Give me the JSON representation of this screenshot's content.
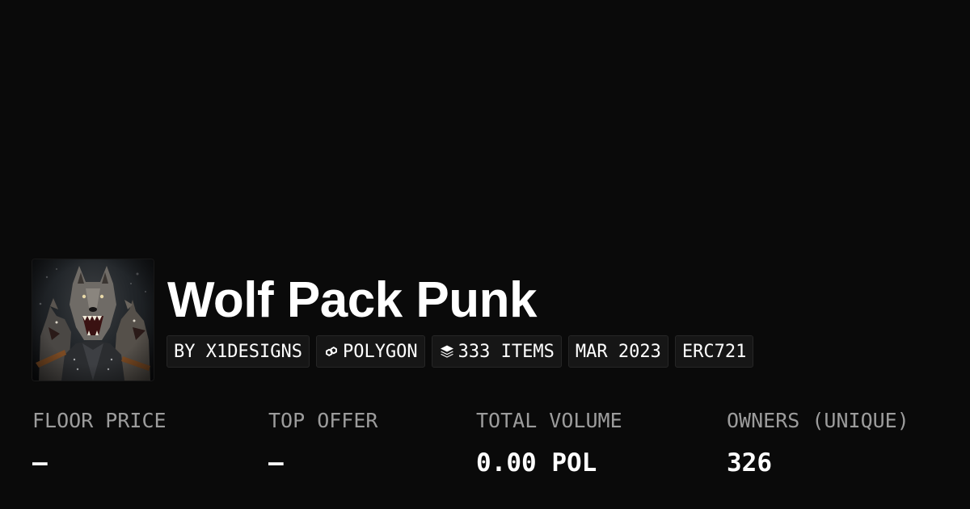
{
  "collection": {
    "title": "Wolf Pack Punk",
    "tags": [
      {
        "label": "BY X1DESIGNS",
        "icon": ""
      },
      {
        "label": "POLYGON",
        "icon": "chain-link-icon"
      },
      {
        "label": "333 ITEMS",
        "icon": "layers-icon"
      },
      {
        "label": "MAR 2023",
        "icon": ""
      },
      {
        "label": "ERC721",
        "icon": ""
      }
    ]
  },
  "stats": [
    {
      "label": "FLOOR PRICE",
      "value": "–"
    },
    {
      "label": "TOP OFFER",
      "value": "–"
    },
    {
      "label": "TOTAL VOLUME",
      "value": "0.00 POL"
    },
    {
      "label": "OWNERS (UNIQUE)",
      "value": "326"
    }
  ],
  "colors": {
    "background": "#0a0a0a",
    "text": "#ffffff",
    "muted_label": "#9c9c9c",
    "tag_background": "#161616",
    "tag_border": "#262626"
  }
}
